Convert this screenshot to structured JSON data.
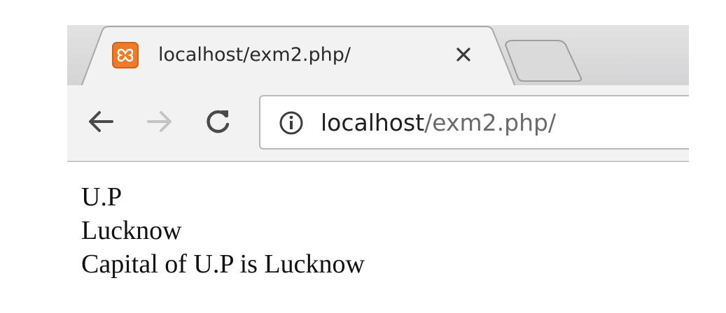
{
  "tab": {
    "title": "localhost/exm2.php/",
    "favicon": "xampp-icon",
    "close": "×"
  },
  "toolbar": {
    "back_icon": "arrow-left-icon",
    "forward_icon": "arrow-right-icon",
    "reload_icon": "reload-icon",
    "site_info_icon": "info-icon"
  },
  "address_bar": {
    "host": "localhost",
    "path": "/exm2.php/"
  },
  "page": {
    "lines": [
      "U.P",
      "Lucknow",
      "Capital of U.P is Lucknow"
    ]
  },
  "colors": {
    "favicon": "#f07b26",
    "tab_bg": "#f2f2f2",
    "strip_bg": "#d6d6d8"
  }
}
